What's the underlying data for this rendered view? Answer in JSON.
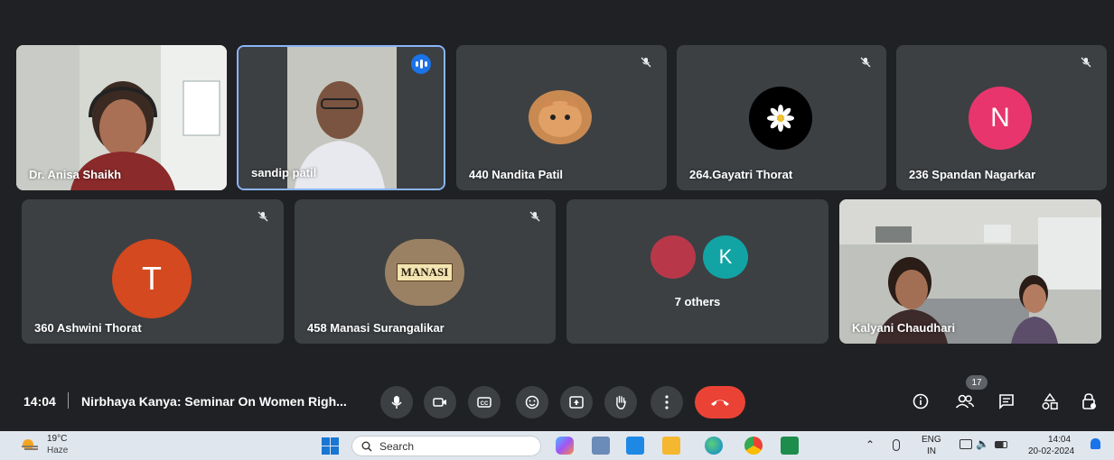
{
  "participants": [
    {
      "name": "Dr. Anisa Shaikh",
      "type": "video"
    },
    {
      "name": "sandip patil",
      "type": "video",
      "speaking": true
    },
    {
      "name": "440 Nandita Patil",
      "type": "avatar-image",
      "muted": true
    },
    {
      "name": "264.Gayatri Thorat",
      "type": "avatar-image",
      "muted": true
    },
    {
      "name": "236 Spandan Nagarkar",
      "type": "initial",
      "initial": "N",
      "color": "#e8356d",
      "muted": true
    },
    {
      "name": "360 Ashwini Thorat",
      "type": "initial",
      "initial": "T",
      "color": "#d4491f",
      "muted": true
    },
    {
      "name": "458 Manasi Surangalikar",
      "type": "avatar-image",
      "avatar_text": "MANASI",
      "muted": true
    },
    {
      "name": "Kalyani Chaudhari",
      "type": "video"
    }
  ],
  "others": {
    "label": "7 others",
    "initial": "K",
    "color": "#12a4a4"
  },
  "meeting": {
    "time": "14:04",
    "title": "Nirbhaya Kanya: Seminar On Women Righ..."
  },
  "controls": [
    "mic-icon",
    "camera-icon",
    "captions-icon",
    "emoji-icon",
    "present-icon",
    "raise-hand-icon",
    "more-icon",
    "end-call-icon"
  ],
  "right_controls": {
    "people_count": "17"
  },
  "taskbar": {
    "weather_temp": "19°C",
    "weather_desc": "Haze",
    "search_placeholder": "Search",
    "lang_top": "ENG",
    "lang_bottom": "IN",
    "clock_time": "14:04",
    "clock_date": "20-02-2024"
  },
  "colors": {
    "background": "#202124",
    "tile": "#3c4043",
    "accent": "#1a73e8",
    "end_call": "#ea4335"
  }
}
